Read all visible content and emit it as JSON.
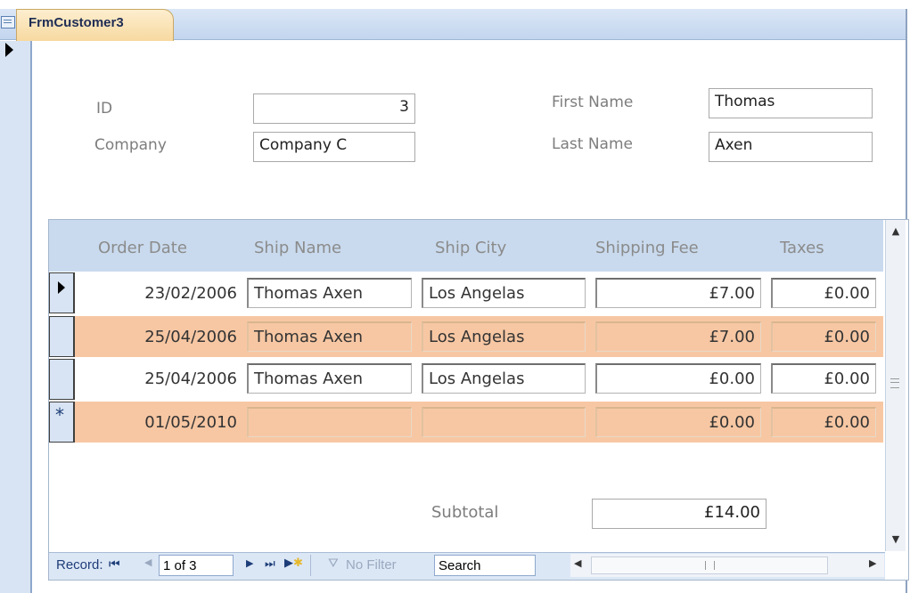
{
  "window": {
    "tab_title": "FrmCustomer3"
  },
  "header": {
    "id_label": "ID",
    "id_value": "3",
    "company_label": "Company",
    "company_value": "Company C",
    "first_name_label": "First Name",
    "first_name_value": "Thomas",
    "last_name_label": "Last Name",
    "last_name_value": "Axen"
  },
  "subform": {
    "columns": [
      "Order Date",
      "Ship Name",
      "Ship City",
      "Shipping Fee",
      "Taxes"
    ],
    "rows": [
      {
        "order_date": "23/02/2006",
        "ship_name": "Thomas Axen",
        "ship_city": "Los Angelas",
        "shipping_fee": "£7.00",
        "taxes": "£0.00"
      },
      {
        "order_date": "25/04/2006",
        "ship_name": "Thomas Axen",
        "ship_city": "Los Angelas",
        "shipping_fee": "£7.00",
        "taxes": "£0.00"
      },
      {
        "order_date": "25/04/2006",
        "ship_name": "Thomas Axen",
        "ship_city": "Los Angelas",
        "shipping_fee": "£0.00",
        "taxes": "£0.00"
      },
      {
        "order_date": "01/05/2010",
        "ship_name": "",
        "ship_city": "",
        "shipping_fee": "£0.00",
        "taxes": "£0.00"
      }
    ],
    "new_record_marker": "*",
    "subtotal_label": "Subtotal",
    "subtotal_value": "£14.00"
  },
  "navigation": {
    "record_label": "Record:",
    "record_position": "1 of 3",
    "filter_label": "No Filter",
    "search_label": "Search"
  },
  "colors": {
    "alt_row": "#f7c7a3",
    "header_band": "#c9daee",
    "tab": "#f7d9a0"
  },
  "icons": [
    "form-icon",
    "record-pointer-icon",
    "first-record-icon",
    "prev-record-icon",
    "next-record-icon",
    "last-record-icon",
    "new-record-icon",
    "filter-icon",
    "scroll-up-icon",
    "scroll-down-icon",
    "scroll-left-icon",
    "scroll-right-icon"
  ]
}
